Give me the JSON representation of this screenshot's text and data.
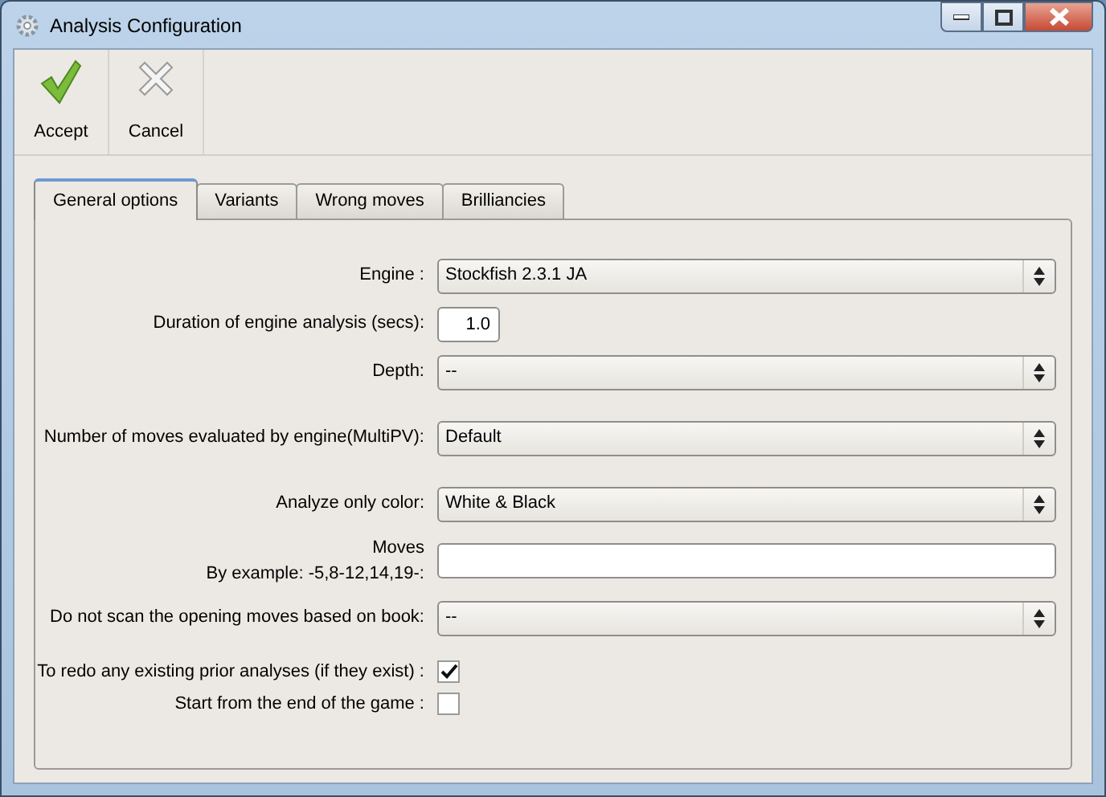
{
  "window": {
    "title": "Analysis Configuration"
  },
  "toolbar": [
    {
      "kind": "accept",
      "label": "Accept"
    },
    {
      "kind": "cancel",
      "label": "Cancel"
    }
  ],
  "tabs": [
    {
      "label": "General options",
      "selected": true
    },
    {
      "label": "Variants",
      "selected": false
    },
    {
      "label": "Wrong moves",
      "selected": false
    },
    {
      "label": "Brilliancies",
      "selected": false
    }
  ],
  "sections": [
    [
      {
        "kind": "select",
        "label": "Engine :",
        "value": "Stockfish 2.3.1 JA"
      },
      {
        "kind": "number",
        "label": "Duration of engine analysis (secs):",
        "value": "1.0"
      },
      {
        "kind": "select",
        "label": "Depth:",
        "value": "--"
      }
    ],
    [
      {
        "kind": "select",
        "label": "Number of moves evaluated by engine(MultiPV):",
        "value": "Default"
      }
    ],
    [
      {
        "kind": "select",
        "label": "Analyze only color:",
        "value": "White & Black"
      },
      {
        "kind": "text",
        "label": "Moves",
        "hint": "By example: -5,8-12,14,19-:"
      },
      {
        "kind": "select",
        "label": "Do not scan the opening moves based on book:",
        "value": "--"
      }
    ],
    [
      {
        "kind": "checkbox",
        "label": "To redo any existing prior analyses (if they exist) :",
        "checked": true
      },
      {
        "kind": "checkbox",
        "label": "Start from the end of the game :",
        "checked": false
      }
    ]
  ]
}
